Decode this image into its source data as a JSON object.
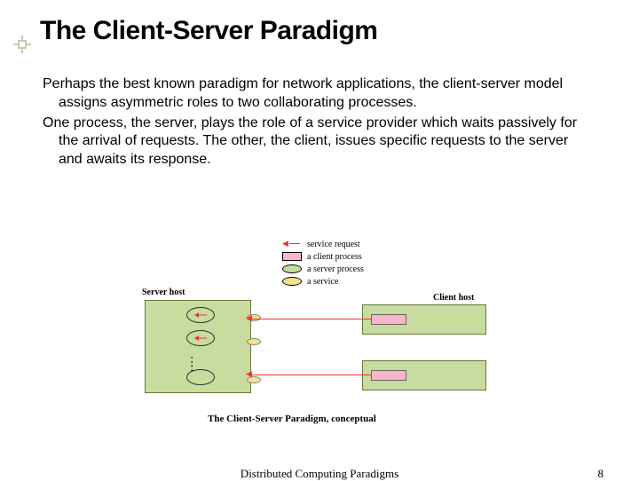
{
  "title": "The Client-Server Paradigm",
  "paragraphs": {
    "p1": "Perhaps the best known paradigm for network applications, the client-server model  assigns asymmetric roles to two collaborating processes.",
    "p2": "One process, the server, plays the role of a service provider which waits passively for the arrival of requests.  The other, the client, issues specific requests to the server and awaits its response."
  },
  "legend": {
    "item1": "service request",
    "item2": "a client process",
    "item3": "a server process",
    "item4": "a service"
  },
  "labels": {
    "server_host": "Server host",
    "client_host": "Client host",
    "dots": "...."
  },
  "caption": "The Client-Server Paradigm, conceptual",
  "footer": {
    "center": "Distributed Computing Paradigms",
    "page": "8"
  },
  "colors": {
    "pink": "#f7b6c9",
    "green": "#c8dca0",
    "yellow": "#f5e18a",
    "arrow": "#e33"
  }
}
